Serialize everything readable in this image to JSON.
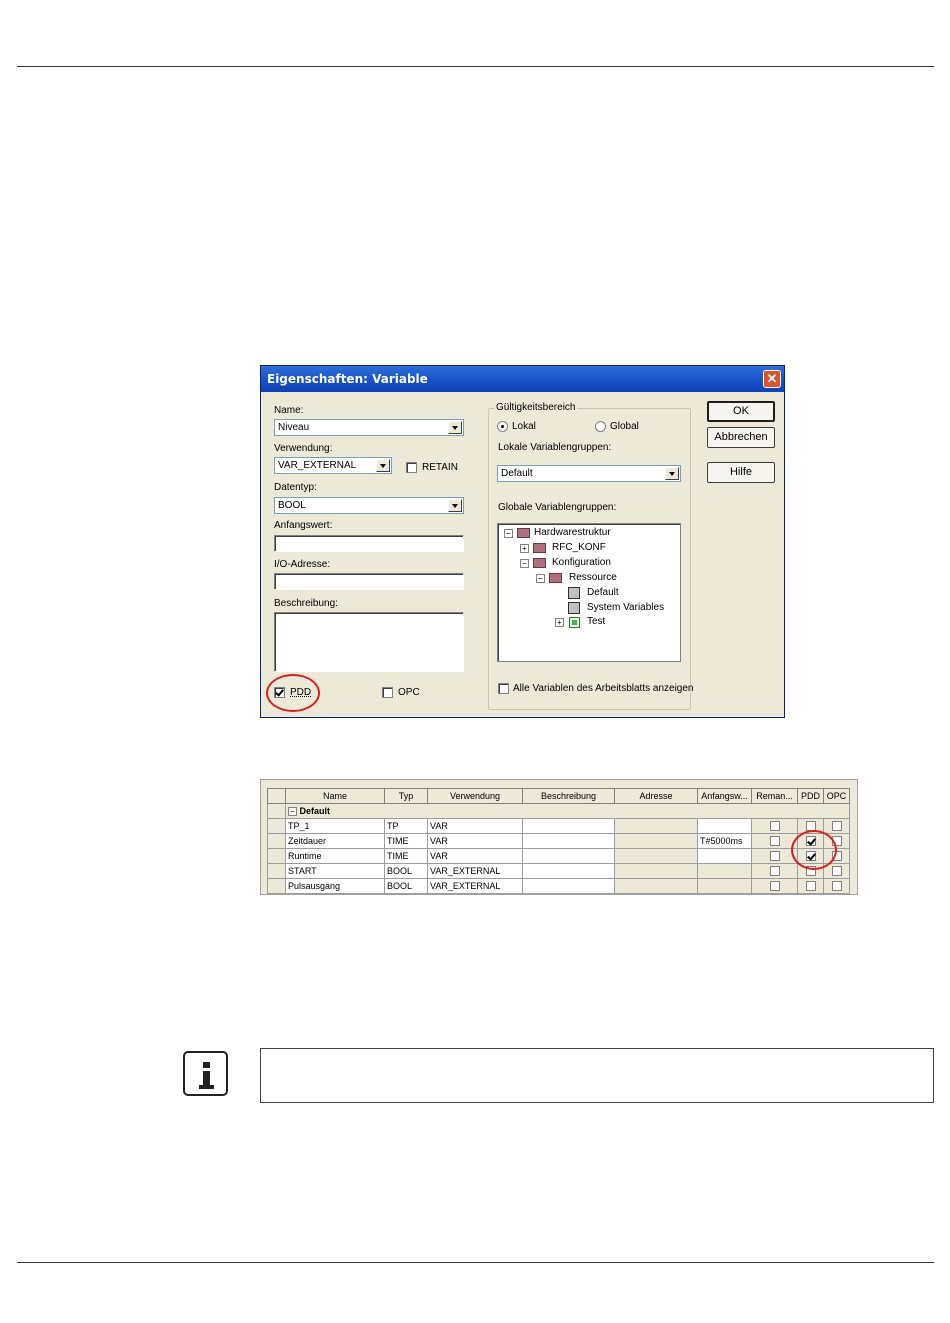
{
  "dialog": {
    "title": "Eigenschaften: Variable",
    "close_glyph": "✕",
    "name_label": "Name:",
    "name_value": "Niveau",
    "verwendung_label": "Verwendung:",
    "verwendung_value": "VAR_EXTERNAL",
    "retain_label": "RETAIN",
    "retain_checked": false,
    "datentyp_label": "Datentyp:",
    "datentyp_value": "BOOL",
    "anfangswert_label": "Anfangswert:",
    "anfangswert_value": "",
    "io_label": "I/O-Adresse:",
    "io_value": "",
    "beschreibung_label": "Beschreibung:",
    "beschreibung_value": "",
    "pdd_label": "PDD",
    "pdd_checked": true,
    "opc_label": "OPC",
    "opc_checked": false,
    "scope_legend": "Gültigkeitsbereich",
    "lokal_label": "Lokal",
    "global_label": "Global",
    "scope_selected": "Lokal",
    "local_groups_label": "Lokale Variablengruppen:",
    "local_groups_value": "Default",
    "global_groups_label": "Globale Variablengruppen:",
    "tree": {
      "root": "Hardwarestruktur",
      "rfc": "RFC_KONF",
      "konfiguration": "Konfiguration",
      "ressource": "Ressource",
      "default": "Default",
      "sysvars": "System Variables",
      "test": "Test"
    },
    "show_all_label": "Alle Variablen des Arbeitsblatts anzeigen",
    "show_all_checked": false,
    "ok_label": "OK",
    "cancel_label": "Abbrechen",
    "help_label": "Hilfe"
  },
  "grid": {
    "headers": [
      "Name",
      "Typ",
      "Verwendung",
      "Beschreibung",
      "Adresse",
      "Anfangsw...",
      "Reman...",
      "PDD",
      "OPC"
    ],
    "group": "Default",
    "rows": [
      {
        "name": "TP_1",
        "typ": "TP",
        "verwendung": "VAR",
        "beschreibung": "",
        "adresse": "",
        "anfangswert": "",
        "remanent": false,
        "pdd": false,
        "opc": false
      },
      {
        "name": "Zeitdauer",
        "typ": "TIME",
        "verwendung": "VAR",
        "beschreibung": "",
        "adresse": "",
        "anfangswert": "T#5000ms",
        "remanent": false,
        "pdd": true,
        "opc": false
      },
      {
        "name": "Runtime",
        "typ": "TIME",
        "verwendung": "VAR",
        "beschreibung": "",
        "adresse": "",
        "anfangswert": "",
        "remanent": false,
        "pdd": true,
        "opc": false
      },
      {
        "name": "START",
        "typ": "BOOL",
        "verwendung": "VAR_EXTERNAL",
        "beschreibung": "",
        "adresse": "",
        "anfangswert": "",
        "remanent": false,
        "pdd": false,
        "opc": false
      },
      {
        "name": "Pulsausgang",
        "typ": "BOOL",
        "verwendung": "VAR_EXTERNAL",
        "beschreibung": "",
        "adresse": "",
        "anfangswert": "",
        "remanent": false,
        "pdd": false,
        "opc": false
      }
    ]
  },
  "info": {
    "text": ""
  },
  "colors": {
    "highlight_circle": "#d92020",
    "titlebar": "#1550c6"
  }
}
